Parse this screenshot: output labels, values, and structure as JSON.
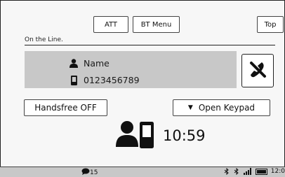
{
  "top_buttons": {
    "att_label": "ATT",
    "bt_menu_label": "BT Menu",
    "top_label": "Top"
  },
  "status_title": "On the Line.",
  "caller": {
    "name": "Name",
    "number": "0123456789"
  },
  "handsfree_label": "Handsfree OFF",
  "keypad_label": "Open Keypad",
  "call_time": "10:59",
  "status_bar": {
    "messages": "15",
    "clock": "12:0"
  },
  "icons": {
    "person": "person-icon",
    "phone": "mobile-phone-icon",
    "end_call": "end-call-icon",
    "call_status": "person-phone-icon",
    "messages": "message-bubble-icon",
    "bluetooth": "bluetooth-icon",
    "signal": "signal-icon",
    "battery": "battery-icon"
  },
  "colors": {
    "panel": "#c8c8c8",
    "background": "#f7f7f7",
    "button": "#ffffff"
  }
}
